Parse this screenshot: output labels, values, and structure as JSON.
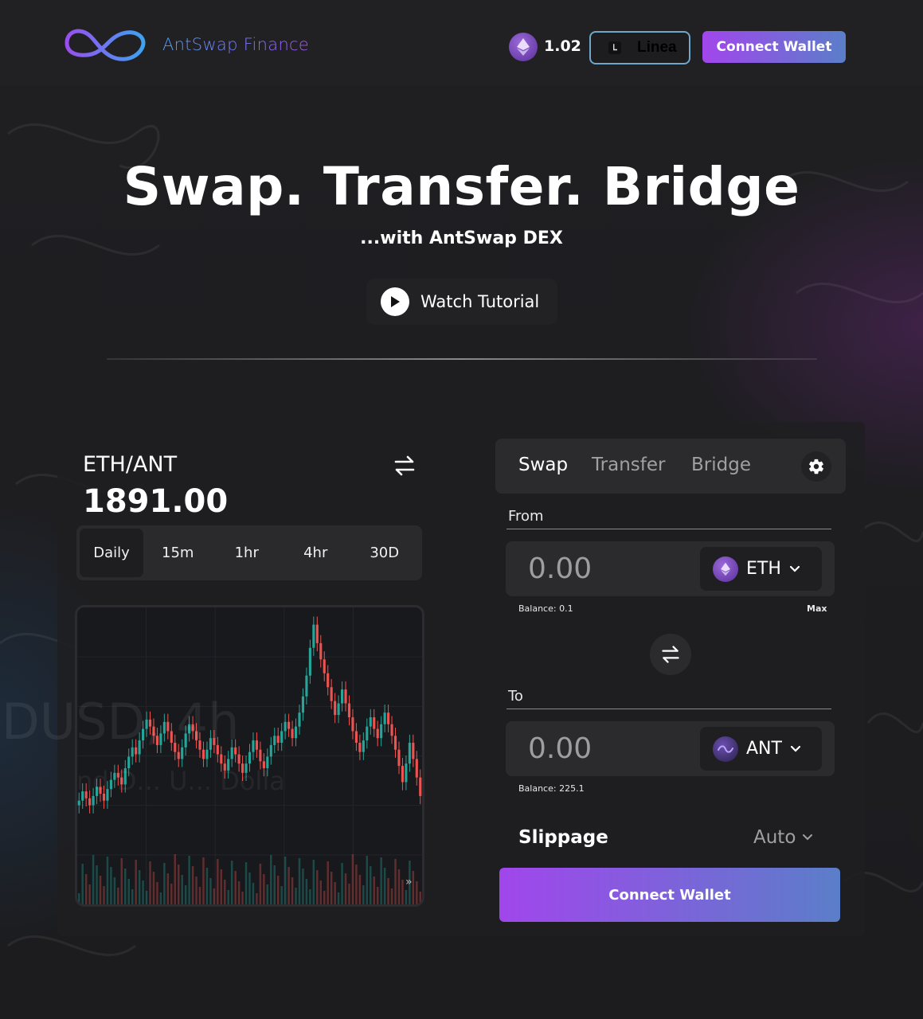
{
  "header": {
    "brand": "AntSwap Finance",
    "eth_balance": "1.02",
    "network": "Linea",
    "connect_label": "Connect Wallet"
  },
  "hero": {
    "title": "Swap. Transfer. Bridge",
    "subtitle": "...with AntSwap DEX",
    "tutorial_label": "Watch Tutorial"
  },
  "chart_panel": {
    "pair": "ETH/ANT",
    "price": "1891.00",
    "timeframes": [
      "Daily",
      "15m",
      "1hr",
      "4hr",
      "30D"
    ],
    "active_timeframe": "Daily",
    "watermark_symbol": "DUSD, 4h",
    "watermark_desc": "nd D... U... Dolla"
  },
  "swap_panel": {
    "tabs": [
      "Swap",
      "Transfer",
      "Bridge"
    ],
    "active_tab": "Swap",
    "from": {
      "label": "From",
      "placeholder": "0.00",
      "token": "ETH",
      "balance": "Balance: 0.1",
      "max_label": "Max"
    },
    "to": {
      "label": "To",
      "placeholder": "0.00",
      "token": "ANT",
      "balance": "Balance: 225.1"
    },
    "slippage_label": "Slippage",
    "slippage_value": "Auto",
    "connect_label": "Connect Wallet"
  },
  "chart_data": {
    "type": "candlestick",
    "title": "",
    "xlabel": "",
    "ylabel": "",
    "ohlc_close": [
      3.0,
      3.4,
      3.1,
      2.8,
      3.2,
      3.6,
      3.3,
      3.0,
      3.5,
      3.9,
      4.2,
      4.0,
      3.7,
      4.4,
      4.9,
      5.3,
      5.0,
      5.6,
      6.1,
      6.5,
      6.2,
      5.8,
      5.4,
      5.9,
      6.4,
      6.0,
      5.5,
      5.1,
      4.8,
      5.3,
      5.9,
      6.3,
      6.0,
      5.6,
      5.2,
      4.8,
      5.2,
      5.7,
      5.4,
      5.0,
      4.6,
      4.3,
      4.8,
      5.3,
      5.0,
      4.6,
      4.2,
      4.6,
      5.1,
      5.6,
      5.2,
      4.7,
      4.4,
      4.9,
      5.4,
      5.8,
      5.5,
      6.0,
      6.4,
      6.1,
      5.7,
      6.2,
      6.8,
      7.5,
      8.4,
      9.6,
      10.6,
      9.8,
      9.1,
      8.5,
      7.9,
      7.3,
      6.7,
      7.2,
      7.8,
      7.2,
      6.6,
      6.0,
      5.5,
      5.1,
      5.6,
      6.2,
      6.6,
      6.1,
      5.7,
      6.3,
      6.8,
      6.3,
      5.8,
      5.2,
      4.5,
      3.8,
      4.6,
      5.5,
      4.8,
      4.0,
      3.2
    ],
    "colors": {
      "up": "#26a69a",
      "down": "#ef5350"
    },
    "grid": true
  },
  "colors": {
    "accent_start": "#a146ec",
    "accent_end": "#5b7ec9",
    "network_border": "#6fa6c9",
    "background": "#1d1d20"
  }
}
